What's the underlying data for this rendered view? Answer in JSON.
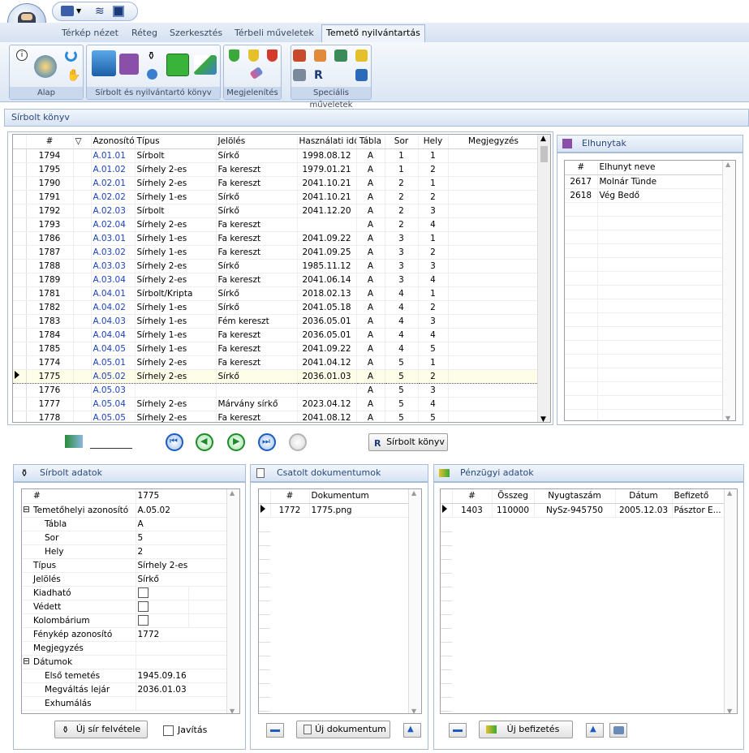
{
  "ribbon": {
    "tabs": [
      "Térkép nézet",
      "Réteg",
      "Szerkesztés",
      "Térbeli műveletek",
      "Temető nyilvántartás"
    ],
    "groups": [
      "Alap",
      "Sírbolt és nyilvántartó könyv",
      "Megjelenítés",
      "Speciális műveletek"
    ]
  },
  "section_title": "Sírbolt könyv",
  "main_grid": {
    "columns": [
      "#",
      "",
      "Azonosító",
      "Típus",
      "Jelölés",
      "Használati idő",
      "Tábla",
      "Sor",
      "Hely",
      "Megjegyzés"
    ],
    "rows": [
      [
        "1794",
        "",
        "A.01.01",
        "Sírbolt",
        "Sírkő",
        "1998.08.12",
        "A",
        "1",
        "1",
        ""
      ],
      [
        "1795",
        "",
        "A.01.02",
        "Sírhely 2-es",
        "Fa kereszt",
        "1979.01.21",
        "A",
        "1",
        "2",
        ""
      ],
      [
        "1790",
        "",
        "A.02.01",
        "Sírhely 2-es",
        "Fa kereszt",
        "2041.10.21",
        "A",
        "2",
        "1",
        ""
      ],
      [
        "1791",
        "",
        "A.02.02",
        "Sírhely 1-es",
        "Sírkő",
        "2041.10.21",
        "A",
        "2",
        "2",
        ""
      ],
      [
        "1792",
        "",
        "A.02.03",
        "Sírbolt",
        "Sírkő",
        "2041.12.20",
        "A",
        "2",
        "3",
        ""
      ],
      [
        "1793",
        "",
        "A.02.04",
        "Sírhely 2-es",
        "Fa kereszt",
        "",
        "A",
        "2",
        "4",
        ""
      ],
      [
        "1786",
        "",
        "A.03.01",
        "Sírhely 1-es",
        "Fa kereszt",
        "2041.09.22",
        "A",
        "3",
        "1",
        ""
      ],
      [
        "1787",
        "",
        "A.03.02",
        "Sírhely 1-es",
        "Fa kereszt",
        "2041.09.25",
        "A",
        "3",
        "2",
        ""
      ],
      [
        "1788",
        "",
        "A.03.03",
        "Sírhely 2-es",
        "Sírkő",
        "1985.11.12",
        "A",
        "3",
        "3",
        ""
      ],
      [
        "1789",
        "",
        "A.03.04",
        "Sírhely 2-es",
        "Fa kereszt",
        "2041.06.14",
        "A",
        "3",
        "4",
        ""
      ],
      [
        "1781",
        "",
        "A.04.01",
        "Sírbolt/Kripta",
        "Sírkő",
        "2018.02.13",
        "A",
        "4",
        "1",
        ""
      ],
      [
        "1782",
        "",
        "A.04.02",
        "Sírhely 1-es",
        "Sírkő",
        "2041.05.18",
        "A",
        "4",
        "2",
        ""
      ],
      [
        "1783",
        "",
        "A.04.03",
        "Sírhely 1-es",
        "Fém kereszt",
        "2036.05.01",
        "A",
        "4",
        "3",
        ""
      ],
      [
        "1784",
        "",
        "A.04.04",
        "Sírhely 1-es",
        "Fa kereszt",
        "2036.05.01",
        "A",
        "4",
        "4",
        ""
      ],
      [
        "1785",
        "",
        "A.04.05",
        "Sírhely 1-es",
        "Fa kereszt",
        "2041.09.22",
        "A",
        "4",
        "5",
        ""
      ],
      [
        "1774",
        "",
        "A.05.01",
        "Sírhely 2-es",
        "Fa kereszt",
        "2041.04.12",
        "A",
        "5",
        "1",
        ""
      ],
      [
        "1775",
        "",
        "A.05.02",
        "Sírhely 2-es",
        "Sírkő",
        "2036.01.03",
        "A",
        "5",
        "2",
        ""
      ],
      [
        "1776",
        "",
        "A.05.03",
        "",
        "",
        "",
        "A",
        "5",
        "3",
        ""
      ],
      [
        "1777",
        "",
        "A.05.04",
        "Sírhely 2-es",
        "Márvány sírkő",
        "2023.04.12",
        "A",
        "5",
        "4",
        ""
      ],
      [
        "1778",
        "",
        "A.05.05",
        "Sírhely 2-es",
        "Fa kereszt",
        "2041.08.12",
        "A",
        "5",
        "5",
        ""
      ]
    ],
    "selected_index": 16
  },
  "deceased": {
    "title": "Elhunytak",
    "columns": [
      "#",
      "Elhunyt neve"
    ],
    "rows": [
      [
        "2617",
        "Molnár Tünde"
      ],
      [
        "2618",
        "Vég Bedő"
      ]
    ]
  },
  "nav": {
    "sirbolt_button": "Sírbolt könyv"
  },
  "details": {
    "title": "Sírbolt adatok",
    "rows": [
      {
        "label": "#",
        "value": "1775",
        "indent": 0,
        "toggle": ""
      },
      {
        "label": "Temetőhelyi azonosító",
        "value": "A.05.02",
        "indent": 0,
        "toggle": "⊟"
      },
      {
        "label": "Tábla",
        "value": "A",
        "indent": 1,
        "toggle": ""
      },
      {
        "label": "Sor",
        "value": "5",
        "indent": 1,
        "toggle": ""
      },
      {
        "label": "Hely",
        "value": "2",
        "indent": 1,
        "toggle": ""
      },
      {
        "label": "Típus",
        "value": "Sírhely 2-es",
        "indent": 0,
        "toggle": ""
      },
      {
        "label": "Jelölés",
        "value": "Sírkő",
        "indent": 0,
        "toggle": ""
      },
      {
        "label": "Kiadható",
        "value": "",
        "indent": 0,
        "toggle": "",
        "checkbox": true
      },
      {
        "label": "Védett",
        "value": "",
        "indent": 0,
        "toggle": "",
        "checkbox": true
      },
      {
        "label": "Kolombárium",
        "value": "",
        "indent": 0,
        "toggle": "",
        "checkbox": true
      },
      {
        "label": "Fénykép azonosító",
        "value": "1772",
        "indent": 0,
        "toggle": ""
      },
      {
        "label": "Megjegyzés",
        "value": "",
        "indent": 0,
        "toggle": ""
      },
      {
        "label": "Dátumok",
        "value": "",
        "indent": 0,
        "toggle": "⊟"
      },
      {
        "label": "Első temetés",
        "value": "1945.09.16",
        "indent": 1,
        "toggle": ""
      },
      {
        "label": "Megváltás lejár",
        "value": "2036.01.03",
        "indent": 1,
        "toggle": ""
      },
      {
        "label": "Exhumálás",
        "value": "",
        "indent": 1,
        "toggle": ""
      }
    ],
    "new_button": "Új sír felvétele",
    "edit_label": "Javítás"
  },
  "documents": {
    "title": "Csatolt dokumentumok",
    "columns": [
      "#",
      "Dokumentum"
    ],
    "rows": [
      [
        "1772",
        "1775.png"
      ]
    ],
    "new_button": "Új dokumentum"
  },
  "finance": {
    "title": "Pénzügyi adatok",
    "columns": [
      "#",
      "Összeg",
      "Nyugtaszám",
      "Dátum",
      "Befizető"
    ],
    "rows": [
      [
        "1403",
        "110000",
        "NySz-945750",
        "2005.12.03",
        "Pásztor E..."
      ]
    ],
    "new_button": "Új befizetés"
  }
}
